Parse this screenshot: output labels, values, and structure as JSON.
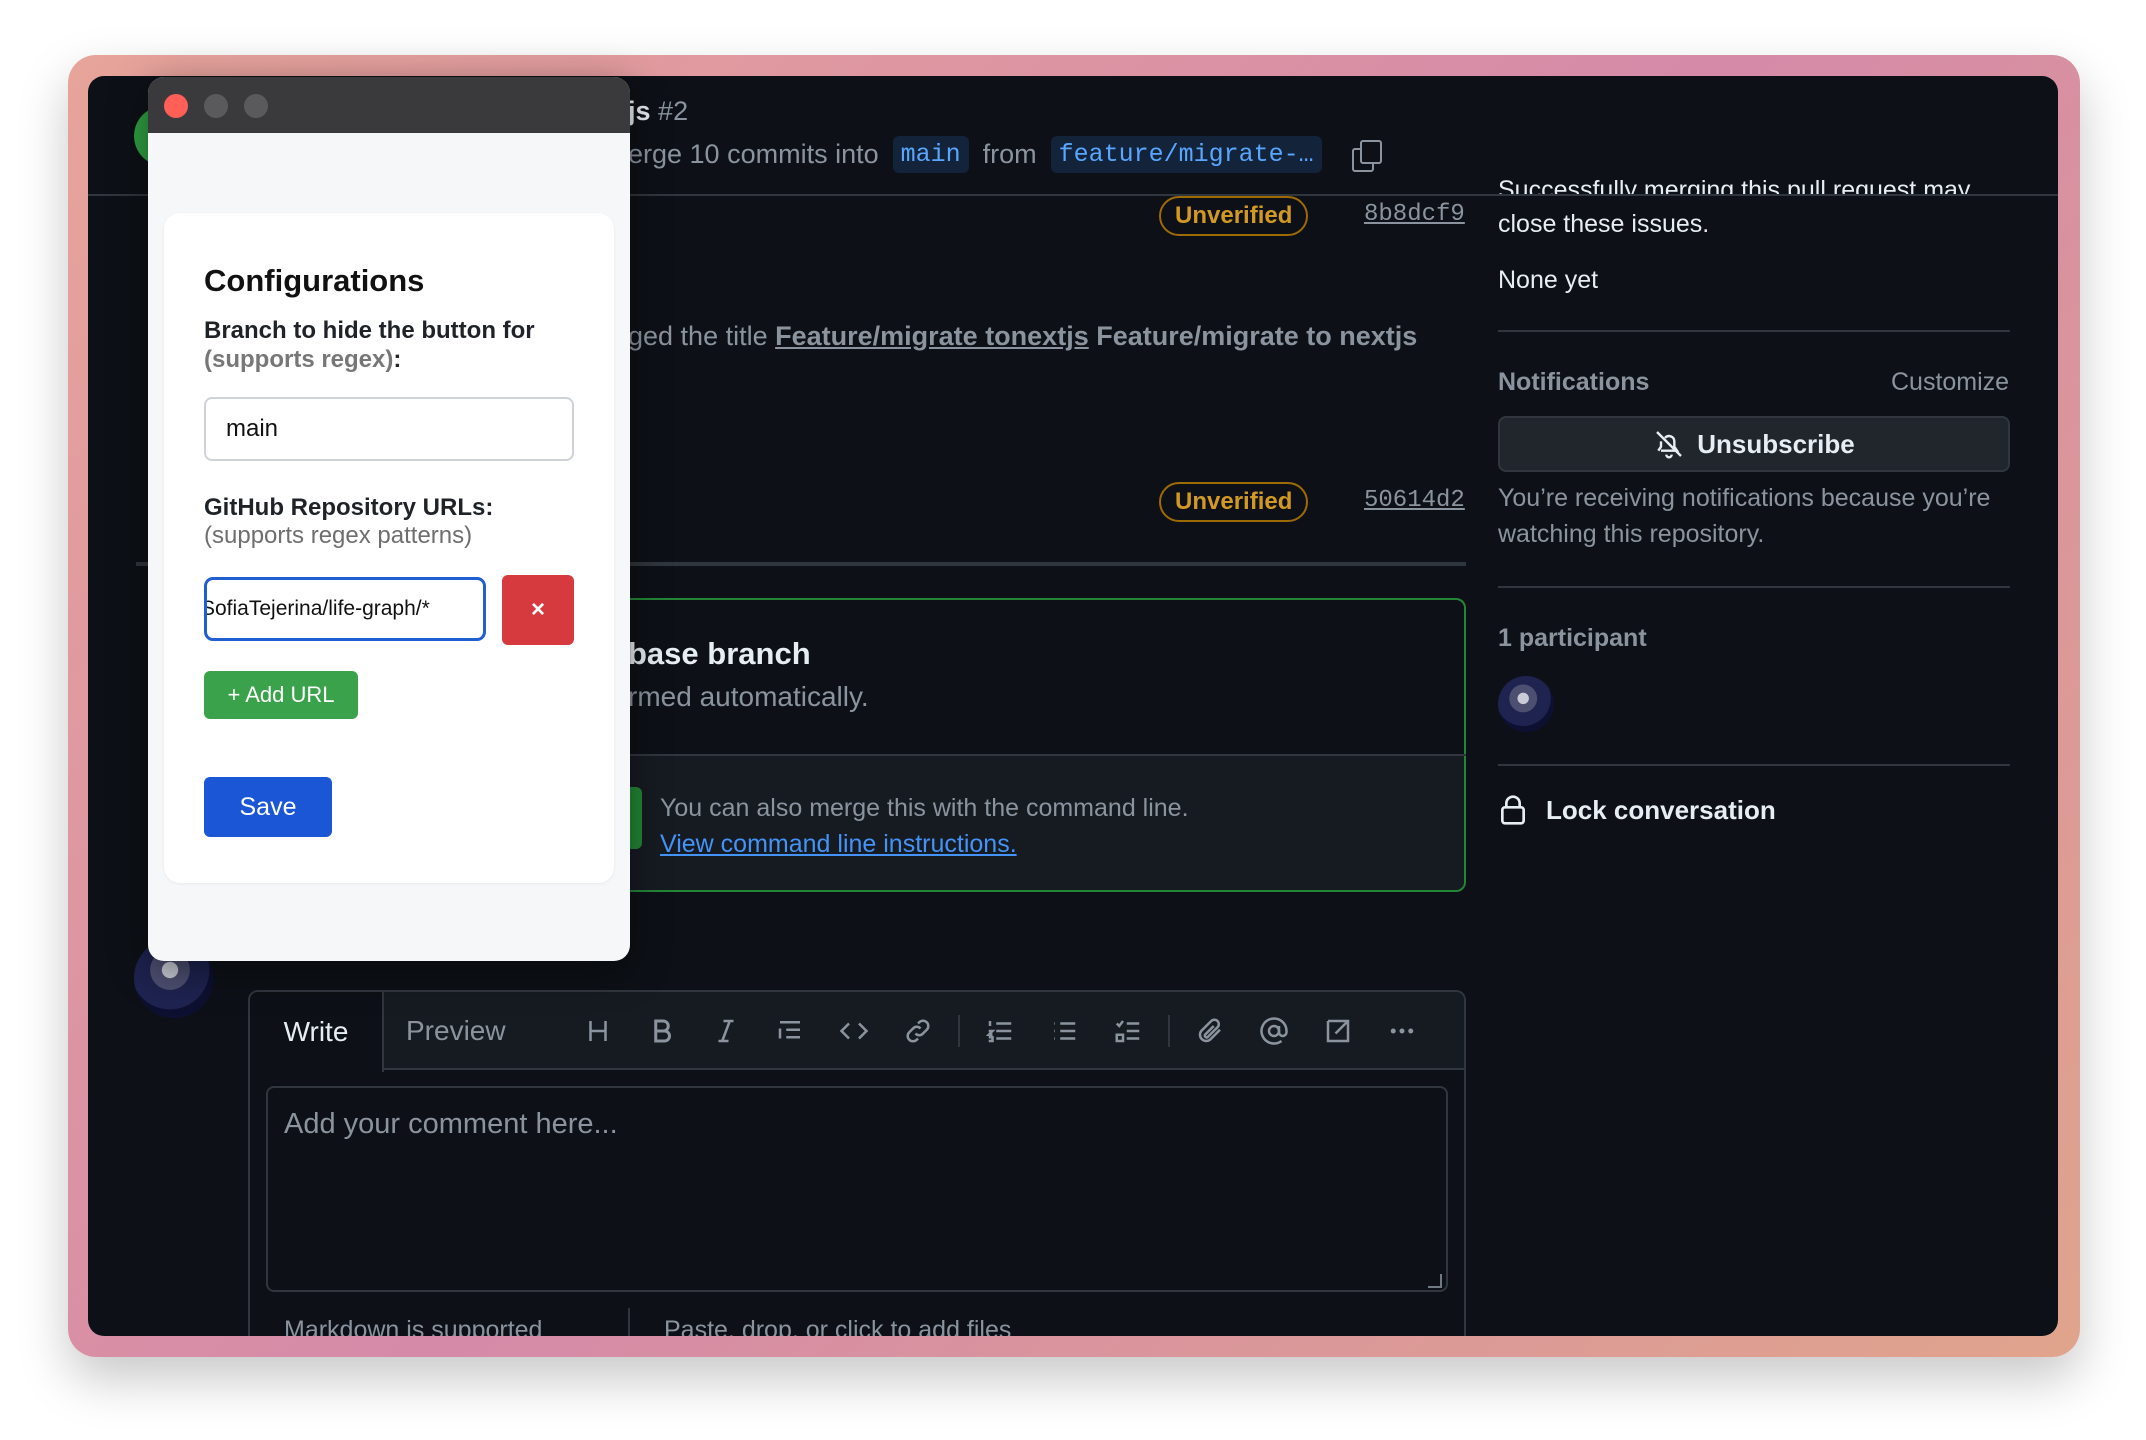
{
  "pr": {
    "title_fragment": "js",
    "number": "#2",
    "subtitle_prefix": "erge 10 commits into",
    "base_branch": "main",
    "from_word": "from",
    "head_branch": "feature/migrate-…"
  },
  "timeline": {
    "commit1": {
      "badge": "Unverified",
      "sha": "8b8dcf9"
    },
    "title_change_prefix": "ged the title",
    "old_title": "Feature/migrate tonextjs",
    "new_title": "Feature/migrate to nextjs",
    "commit2": {
      "badge": "Unverified",
      "sha": "50614d2"
    }
  },
  "merge": {
    "title": "base branch",
    "subtitle": "rmed automatically.",
    "cli_text": "You can also merge this with the command line.",
    "cli_link": "View command line instructions."
  },
  "editor": {
    "tab_write": "Write",
    "tab_preview": "Preview",
    "placeholder": "Add your comment here...",
    "footer_markdown": "Markdown is supported",
    "footer_files": "Paste, drop, or click to add files",
    "tools": [
      "heading-icon",
      "bold-icon",
      "italic-icon",
      "quote-icon",
      "code-icon",
      "link-icon",
      "ordered-list-icon",
      "unordered-list-icon",
      "task-list-icon",
      "attach-icon",
      "mention-icon",
      "reference-icon",
      "more-icon"
    ]
  },
  "sidebar": {
    "issues_cut": "Successfully merging this pull request may",
    "issues_text": "close these issues.",
    "none_yet": "None yet",
    "notifications_heading": "Notifications",
    "customize": "Customize",
    "unsubscribe": "Unsubscribe",
    "notif_reason": "You’re receiving notifications because you’re watching this repository.",
    "participants": "1 participant",
    "lock": "Lock conversation"
  },
  "popup": {
    "title": "Configurations",
    "branch_label": "Branch to hide the button for",
    "branch_hint": "(supports regex)",
    "branch_colon": ":",
    "branch_value": "main",
    "urls_label": "GitHub Repository URLs:",
    "urls_hint": "(supports regex patterns)",
    "url_value": "SofiaTejerina/life-graph/*",
    "delete_label": "×",
    "add_label": "+ Add URL",
    "save_label": "Save"
  },
  "colors": {
    "accent_blue": "#1a56d6",
    "add_green": "#3aa24a",
    "delete_red": "#d63a3f",
    "merge_border": "#238636",
    "unverified": "#d29922"
  }
}
